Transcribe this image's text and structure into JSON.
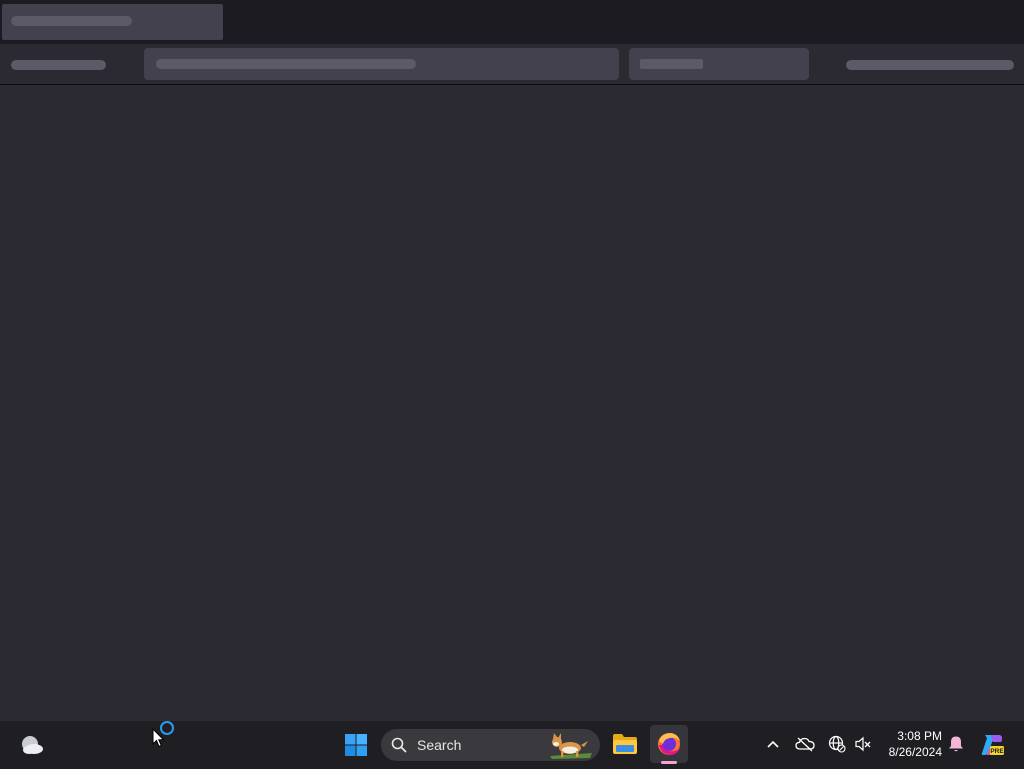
{
  "taskbar": {
    "search_label": "Search",
    "time": "3:08 PM",
    "date": "8/26/2024",
    "copilot_badge": "PRE",
    "icons": [
      "weather-icon",
      "windows-start-icon",
      "search-icon",
      "file-explorer-icon",
      "firefox-icon",
      "chevron-up-icon",
      "onedrive-icon",
      "network-icon",
      "volume-muted-icon",
      "notification-bell-icon",
      "copilot-icon"
    ]
  },
  "colors": {
    "tabstrip": "#1c1b22",
    "toolbar": "#2b2a33",
    "content": "#2b2a33",
    "placeholder": "#42414d",
    "taskbar": "#1f1f23",
    "accent_busy": "#2b9cf0"
  }
}
